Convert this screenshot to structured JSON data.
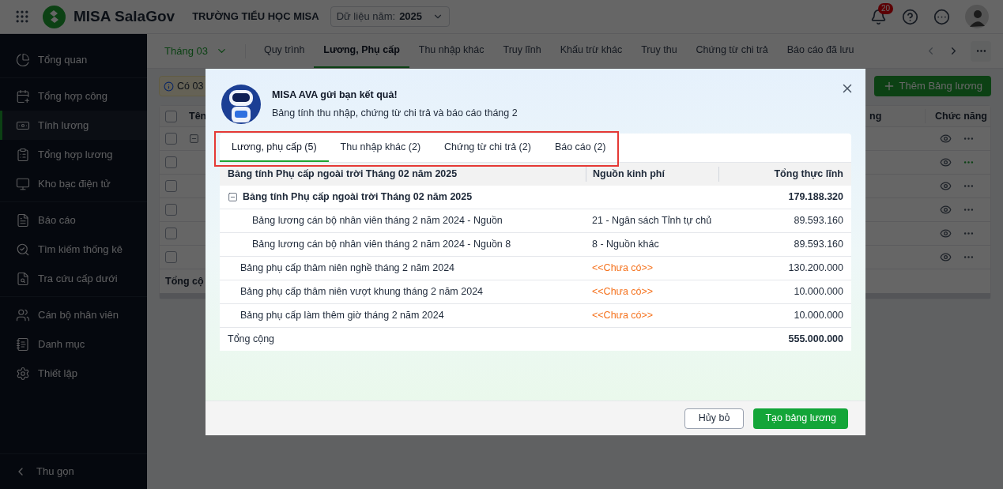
{
  "app": {
    "name": "MISA SalaGov",
    "organization": "TRƯỜNG TIỂU HỌC MISA",
    "year_selector": {
      "label": "Dữ liệu năm:",
      "value": "2025"
    },
    "notifications_badge": "20"
  },
  "sidebar": {
    "sections": [
      [
        {
          "label": "Tổng quan",
          "selected": false
        }
      ],
      [
        {
          "label": "Tổng hợp công",
          "selected": false
        },
        {
          "label": "Tính lương",
          "selected": true
        },
        {
          "label": "Tổng hợp lương",
          "selected": false
        },
        {
          "label": "Kho bạc điện tử",
          "selected": false
        }
      ],
      [
        {
          "label": "Báo cáo",
          "selected": false
        },
        {
          "label": "Tìm kiếm thống kê",
          "selected": false
        },
        {
          "label": "Tra cứu cấp dưới",
          "selected": false
        }
      ],
      [
        {
          "label": "Cán bộ nhân viên",
          "selected": false
        },
        {
          "label": "Danh mục",
          "selected": false
        },
        {
          "label": "Thiết lập",
          "selected": false
        }
      ]
    ],
    "collapse": "Thu gọn"
  },
  "month_selector": "Tháng 03",
  "tabs": [
    {
      "label": "Quy trình",
      "selected": false
    },
    {
      "label": "Lương, Phụ cấp",
      "selected": true
    },
    {
      "label": "Thu nhập khác",
      "selected": false
    },
    {
      "label": "Truy lĩnh",
      "selected": false
    },
    {
      "label": "Khấu trừ khác",
      "selected": false
    },
    {
      "label": "Truy thu",
      "selected": false
    },
    {
      "label": "Chứng từ chi trả",
      "selected": false
    },
    {
      "label": "Báo cáo đã lưu",
      "selected": false
    }
  ],
  "notice": "Có 03",
  "add_button": "Thêm Bảng lương",
  "table": {
    "columns": [
      "Tên",
      "ng",
      "Chức năng"
    ],
    "select_all_checked": false,
    "rows": [
      {
        "kind": "group",
        "highlighted": false,
        "checked": false
      },
      {
        "kind": "item",
        "highlighted": true,
        "checked": false
      },
      {
        "kind": "item",
        "highlighted": false,
        "checked": false
      },
      {
        "kind": "item",
        "highlighted": false,
        "checked": false
      },
      {
        "kind": "item",
        "highlighted": false,
        "checked": false
      },
      {
        "kind": "item",
        "highlighted": false,
        "checked": false
      }
    ],
    "total_label": "Tổng cộ"
  },
  "modal": {
    "title": "MISA AVA gửi bạn kết quả!",
    "subtitle": "Bảng tính thu nhập, chứng từ chi trả và báo cáo tháng 2",
    "tabs": [
      {
        "label": "Lương, phụ cấp (5)",
        "selected": true
      },
      {
        "label": "Thu nhập khác (2)",
        "selected": false
      },
      {
        "label": "Chứng từ chi trả (2)",
        "selected": false
      },
      {
        "label": "Báo cáo (2)",
        "selected": false
      }
    ],
    "table": {
      "columns": [
        "Bảng tính Phụ cấp ngoài trời Tháng 02 năm 2025",
        "Nguồn kinh phí",
        "Tổng thực lĩnh"
      ],
      "rows": [
        {
          "name": "Bảng tính Phụ cấp ngoài trời Tháng 02 năm 2025",
          "total": "179.188.320",
          "expanded": true,
          "children": [
            {
              "name": "Bảng lương cán bộ nhân viên tháng 2 năm 2024 - Nguồn",
              "source": "21 - Ngân sách Tỉnh tự chủ",
              "source_missing": false,
              "total": "89.593.160"
            },
            {
              "name": "Bảng lương cán bộ nhân viên tháng 2 năm 2024 - Nguồn 8",
              "source": "8 - Nguồn khác",
              "source_missing": false,
              "total": "89.593.160"
            }
          ]
        },
        {
          "name": "Bảng phụ cấp thâm niên nghề tháng 2 năm 2024",
          "source": "<<Chưa có>>",
          "source_missing": true,
          "total": "130.200.000"
        },
        {
          "name": "Bảng phụ cấp thâm niên vượt khung tháng 2 năm 2024",
          "source": "<<Chưa có>>",
          "source_missing": true,
          "total": "10.000.000"
        },
        {
          "name": "Bảng phụ cấp làm thêm giờ tháng 2 năm 2024",
          "source": "<<Chưa có>>",
          "source_missing": true,
          "total": "10.000.000"
        }
      ],
      "total": {
        "label": "Tổng cộng",
        "value": "555.000.000"
      }
    },
    "buttons": {
      "cancel": "Hủy bỏ",
      "confirm": "Tạo bảng lương"
    }
  }
}
